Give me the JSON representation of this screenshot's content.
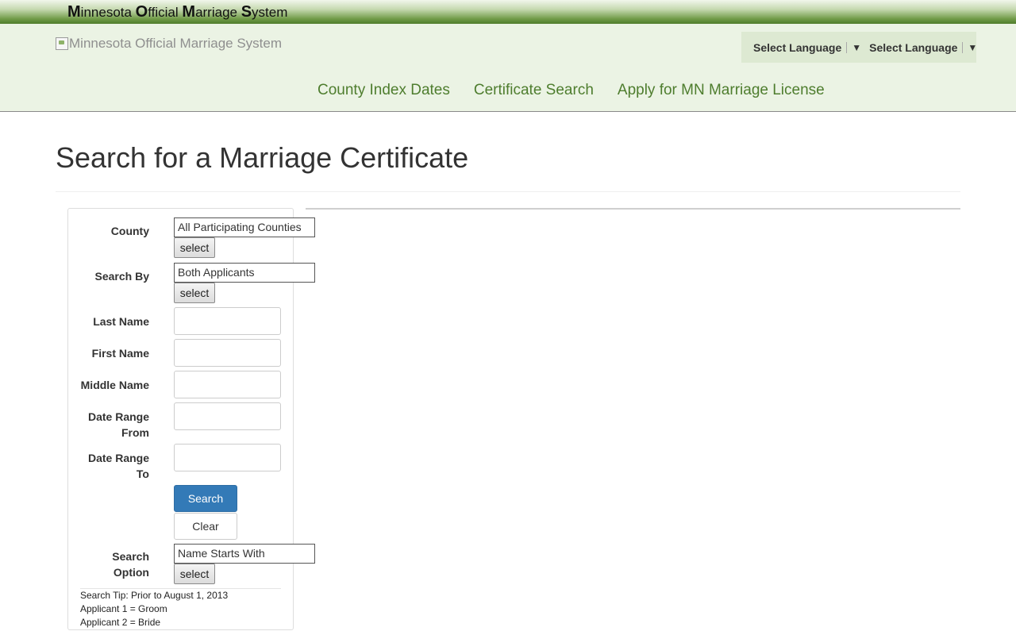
{
  "site": {
    "title_parts": [
      {
        "cap": "M",
        "rest": "innesota "
      },
      {
        "cap": "O",
        "rest": "fficial "
      },
      {
        "cap": "M",
        "rest": "arriage "
      },
      {
        "cap": "S",
        "rest": "ystem"
      }
    ],
    "logo_alt": "Minnesota Official Marriage System"
  },
  "language": {
    "items": [
      "Select Language",
      "Select Language"
    ],
    "arrow": "▼"
  },
  "nav": {
    "items": [
      "County Index Dates",
      "Certificate Search",
      "Apply for MN Marriage License"
    ]
  },
  "page": {
    "title": "Search for a Marriage Certificate"
  },
  "form": {
    "county": {
      "label": "County",
      "value": "All Participating Counties",
      "button": "select"
    },
    "search_by": {
      "label": "Search By",
      "value": "Both Applicants",
      "button": "select"
    },
    "last_name": {
      "label": "Last Name",
      "value": ""
    },
    "first_name": {
      "label": "First Name",
      "value": ""
    },
    "middle_name": {
      "label": "Middle Name",
      "value": ""
    },
    "date_from": {
      "label_line1": "Date Range",
      "label_line2": "From",
      "value": ""
    },
    "date_to": {
      "label_line1": "Date Range",
      "label_line2": "To",
      "value": ""
    },
    "search_button": "Search",
    "clear_button": "Clear",
    "search_option": {
      "label_line1": "Search",
      "label_line2": "Option",
      "value": "Name Starts With",
      "button": "select"
    },
    "tip": {
      "line1": "Search Tip: Prior to August 1, 2013",
      "line2": "Applicant 1 = Groom",
      "line3": "Applicant 2 = Bride"
    }
  },
  "colors": {
    "nav_link": "#4e7d2e",
    "header_bg": "#ebf3e4",
    "primary_button": "#337ab7"
  }
}
